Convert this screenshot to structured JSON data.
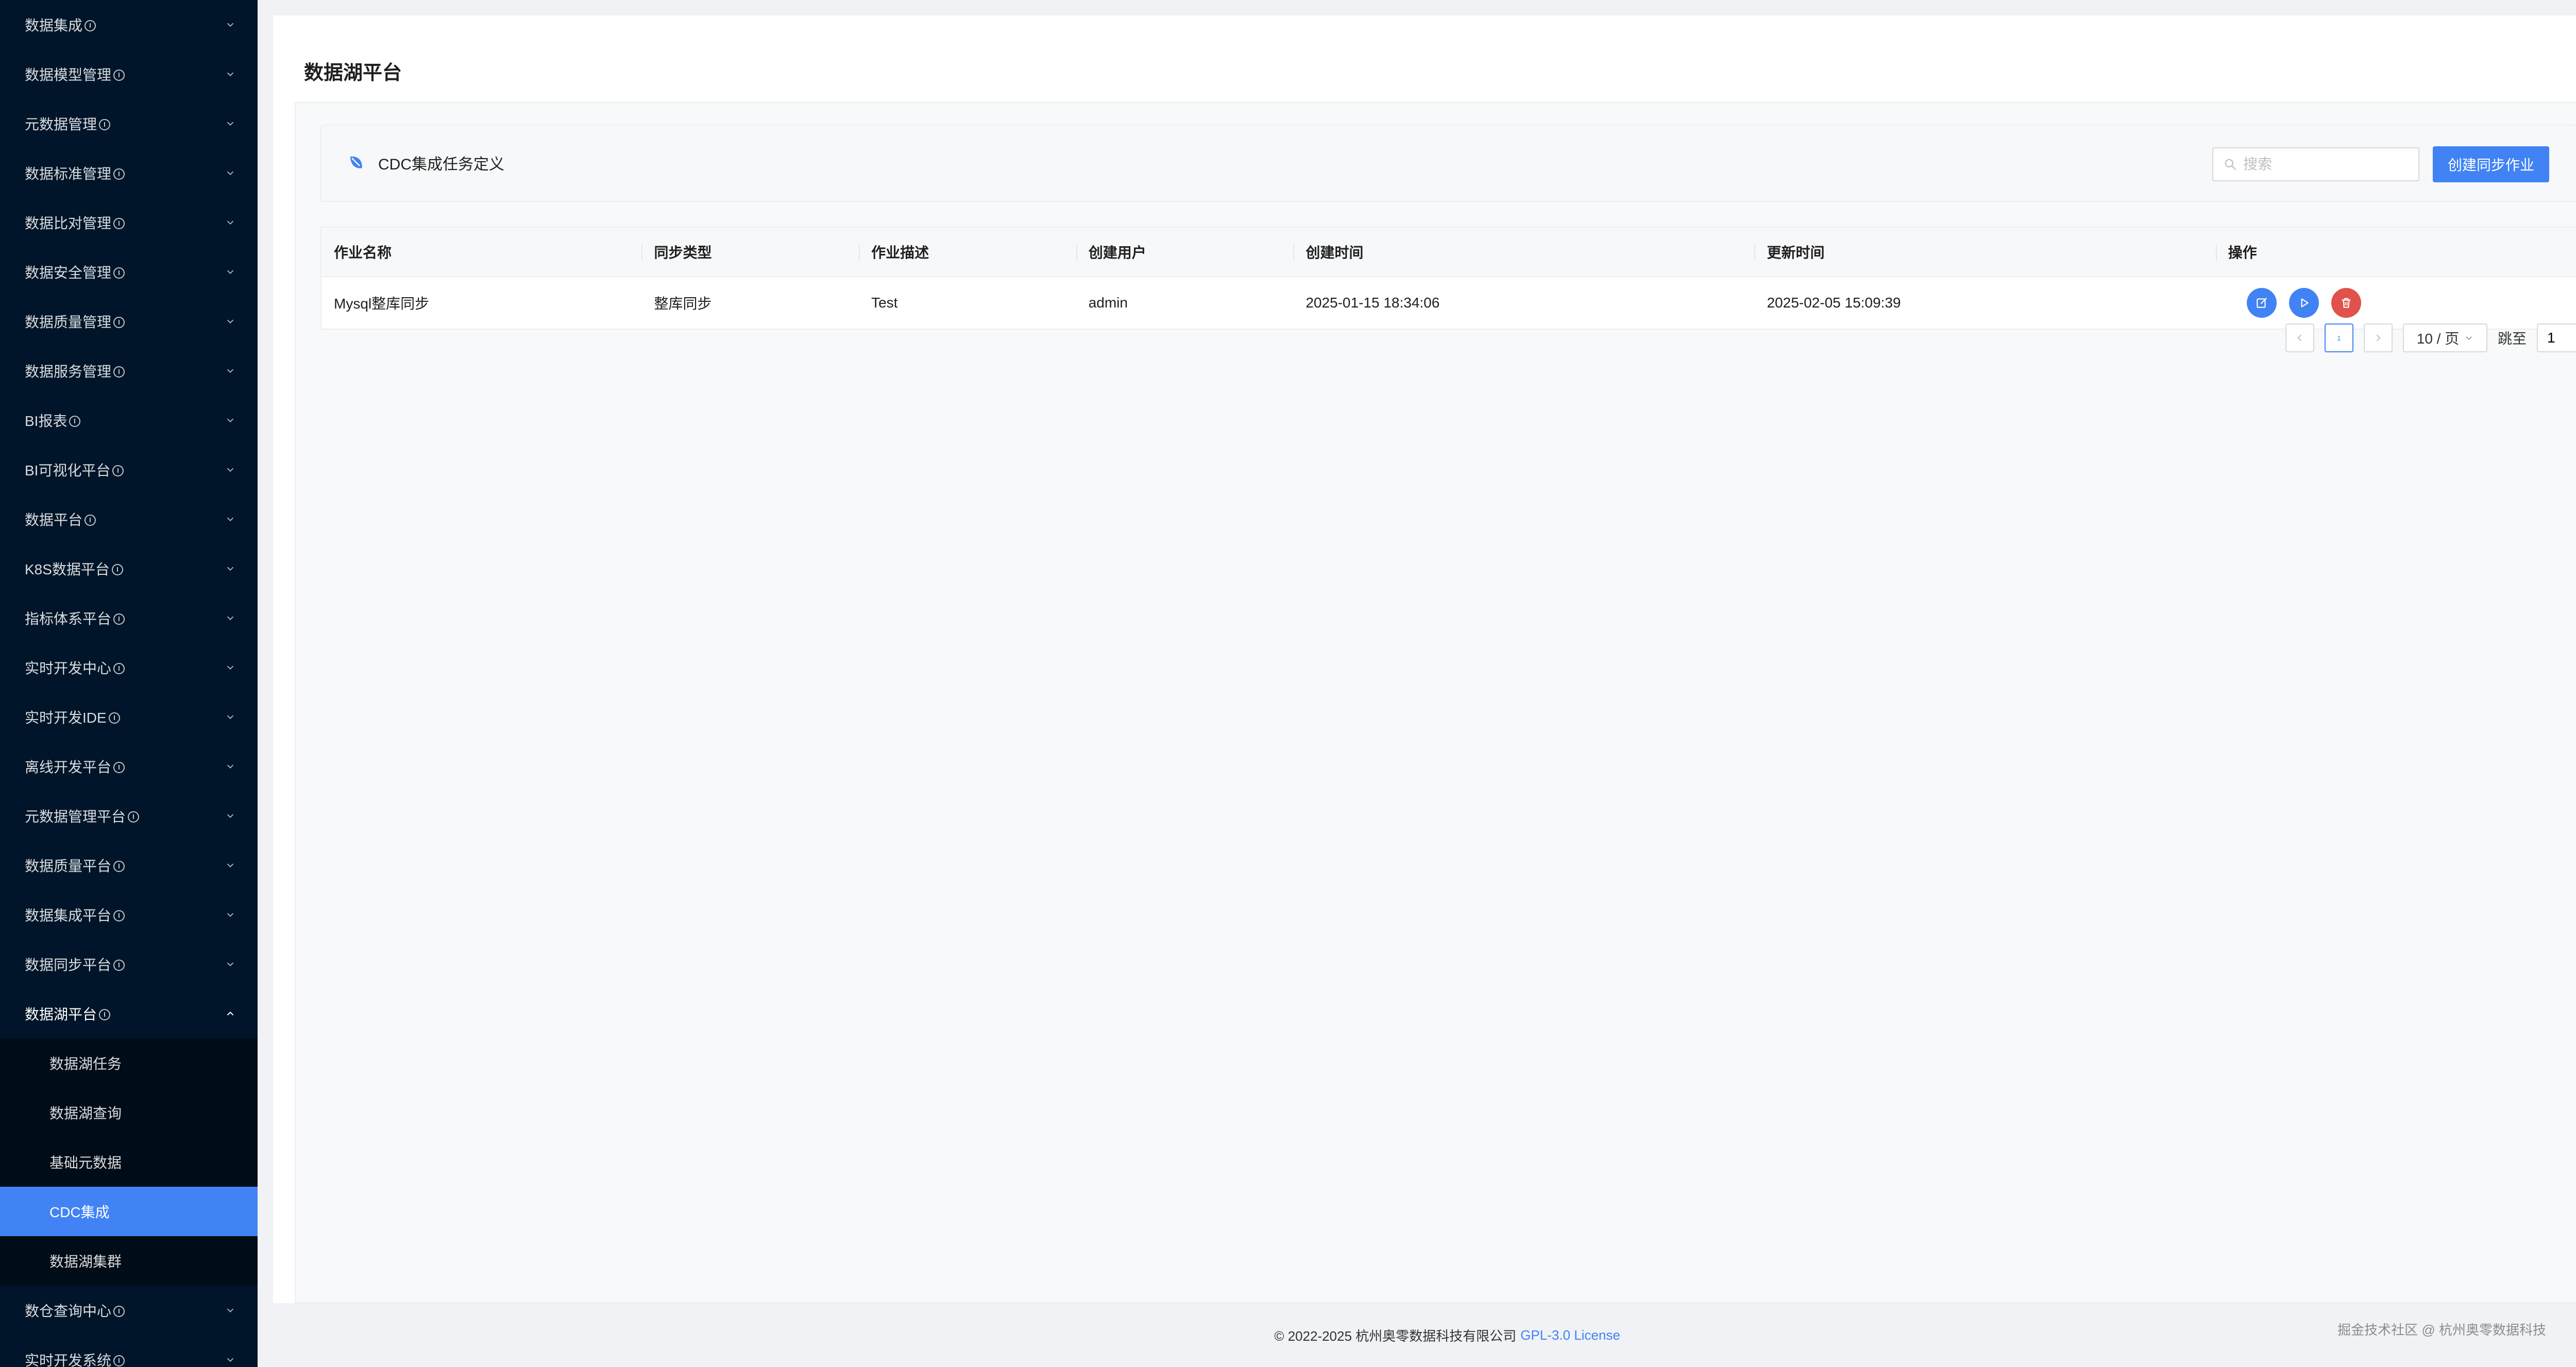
{
  "sidebar": {
    "items": [
      {
        "label": "数据集成"
      },
      {
        "label": "数据模型管理"
      },
      {
        "label": "元数据管理"
      },
      {
        "label": "数据标准管理"
      },
      {
        "label": "数据比对管理"
      },
      {
        "label": "数据安全管理"
      },
      {
        "label": "数据质量管理"
      },
      {
        "label": "数据服务管理"
      },
      {
        "label": "BI报表"
      },
      {
        "label": "BI可视化平台"
      },
      {
        "label": "数据平台"
      },
      {
        "label": "K8S数据平台"
      },
      {
        "label": "指标体系平台"
      },
      {
        "label": "实时开发中心"
      },
      {
        "label": "实时开发IDE"
      },
      {
        "label": "离线开发平台"
      },
      {
        "label": "元数据管理平台"
      },
      {
        "label": "数据质量平台"
      },
      {
        "label": "数据集成平台"
      },
      {
        "label": "数据同步平台"
      }
    ],
    "open_item": {
      "label": "数据湖平台"
    },
    "sub_items": [
      {
        "label": "数据湖任务"
      },
      {
        "label": "数据湖查询"
      },
      {
        "label": "基础元数据"
      },
      {
        "label": "CDC集成"
      },
      {
        "label": "数据湖集群"
      }
    ],
    "after_items": [
      {
        "label": "数仓查询中心"
      },
      {
        "label": "实时开发系统"
      }
    ]
  },
  "main": {
    "page_title": "数据湖平台",
    "card_title": "CDC集成任务定义",
    "search_placeholder": "搜索",
    "create_button": "创建同步作业",
    "table": {
      "columns": [
        "作业名称",
        "同步类型",
        "作业描述",
        "创建用户",
        "创建时间",
        "更新时间",
        "操作"
      ],
      "rows": [
        {
          "name": "Mysql整库同步",
          "sync_type": "整库同步",
          "description": "Test",
          "user": "admin",
          "created": "2025-01-15 18:34:06",
          "updated": "2025-02-05 15:09:39"
        }
      ]
    },
    "pagination": {
      "current_page": "1",
      "page_size": "10 / 页",
      "jump_label": "跳至",
      "jump_value": "1"
    }
  },
  "footer": {
    "copyright": "© 2022-2025 杭州奥零数据科技有限公司",
    "license_link": "GPL-3.0 License",
    "watermark": "掘金技术社区 @ 杭州奥零数据科技"
  },
  "colors": {
    "sidebar_bg": "#001529",
    "submenu_bg": "#000c17",
    "accent": "#4183f4",
    "danger": "#e0524b"
  },
  "icons": {
    "chevron_down": "chevron-down-icon",
    "chevron_up": "chevron-up-icon",
    "leaf": "leaf-icon",
    "search": "search-icon",
    "edit": "edit-icon",
    "play": "play-icon",
    "delete": "trash-icon"
  }
}
